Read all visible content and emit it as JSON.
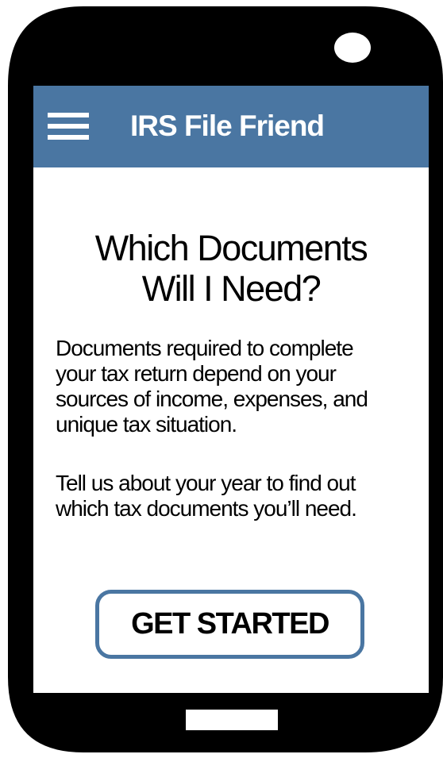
{
  "app_bar": {
    "title": "IRS File Friend",
    "menu_icon": "hamburger-menu-icon",
    "background_color": "#4a76a2"
  },
  "main": {
    "headline_line1": "Which Documents",
    "headline_line2": "Will I Need?",
    "paragraph1_lines": [
      "Documents required to complete",
      "your tax return depend on your",
      "sources of income, expenses, and",
      "unique tax situation."
    ],
    "paragraph2_lines": [
      "Tell us about your year to find out",
      "which tax documents you’ll need."
    ],
    "cta_label": "GET STARTED",
    "cta_border_color": "#4a76a2"
  },
  "device": {
    "body_color": "#000000",
    "camera_icon": "camera-icon",
    "home_button_icon": "home-button-icon"
  }
}
